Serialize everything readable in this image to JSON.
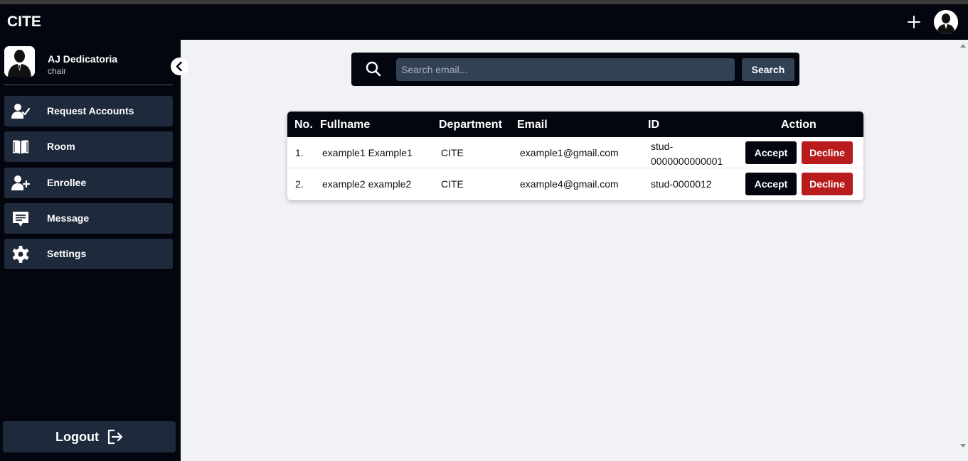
{
  "app": {
    "brand": "CITE"
  },
  "header": {
    "add_icon": "plus-icon",
    "avatar_icon": "user-avatar"
  },
  "profile": {
    "name": "AJ Dedicatoria",
    "role": "chair"
  },
  "sidebar": {
    "items": [
      {
        "label": "Request Accounts",
        "icon": "user-check-icon"
      },
      {
        "label": "Room",
        "icon": "book-icon"
      },
      {
        "label": "Enrollee",
        "icon": "user-plus-icon"
      },
      {
        "label": "Message",
        "icon": "message-icon"
      },
      {
        "label": "Settings",
        "icon": "gear-icon"
      }
    ],
    "logout_label": "Logout"
  },
  "search": {
    "placeholder": "Search email...",
    "value": "",
    "button_label": "Search"
  },
  "table": {
    "headers": [
      "No.",
      "Fullname",
      "Department",
      "Email",
      "ID",
      "Action"
    ],
    "rows": [
      {
        "no": "1.",
        "fullname": "example1 Example1",
        "department": "CITE",
        "email": "example1@gmail.com",
        "id": "stud-0000000000001",
        "accept": "Accept",
        "decline": "Decline"
      },
      {
        "no": "2.",
        "fullname": "example2 example2",
        "department": "CITE",
        "email": "example4@gmail.com",
        "id": "stud-0000012",
        "accept": "Accept",
        "decline": "Decline"
      }
    ]
  },
  "colors": {
    "primary_dark": "#03060f",
    "nav_item": "#1e293b",
    "decline": "#b91c1c",
    "content_bg": "#f0f2f6",
    "search_field": "#334155"
  }
}
